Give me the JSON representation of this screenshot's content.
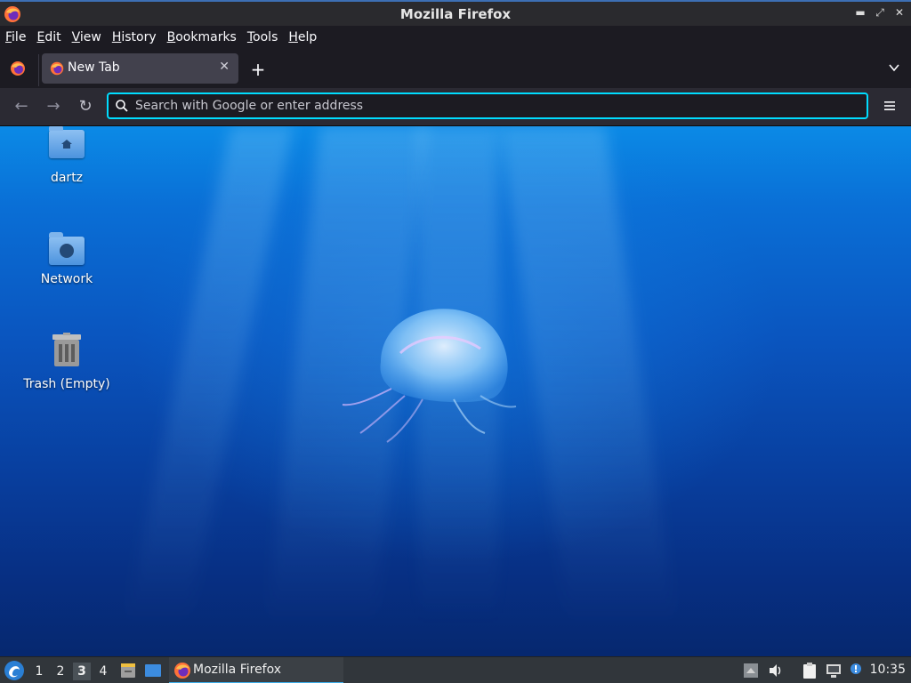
{
  "window": {
    "title": "Mozilla Firefox",
    "controls": [
      "minimize",
      "maximize",
      "close"
    ]
  },
  "menubar": {
    "items": [
      "File",
      "Edit",
      "View",
      "History",
      "Bookmarks",
      "Tools",
      "Help"
    ]
  },
  "tabs": [
    {
      "label": "New Tab",
      "active": true
    }
  ],
  "navbar": {
    "search_placeholder": "Search with Google or enter address",
    "search_value": ""
  },
  "desktop": {
    "icons": [
      {
        "label": "dartz",
        "icon": "home-folder-icon"
      },
      {
        "label": "Network",
        "icon": "network-folder-icon"
      },
      {
        "label": "Trash (Empty)",
        "icon": "trash-icon"
      }
    ]
  },
  "taskbar": {
    "workspaces": [
      "1",
      "2",
      "3",
      "4"
    ],
    "active_workspace": "3",
    "tasks": [
      {
        "label": "Mozilla Firefox",
        "icon": "firefox-icon"
      }
    ],
    "clock": "10:35"
  },
  "colors": {
    "accent": "#00ddff",
    "toolbar": "#2b2a33",
    "tabbar": "#1c1b22",
    "taskbar": "#31363b",
    "task_highlight": "#3daee9"
  }
}
